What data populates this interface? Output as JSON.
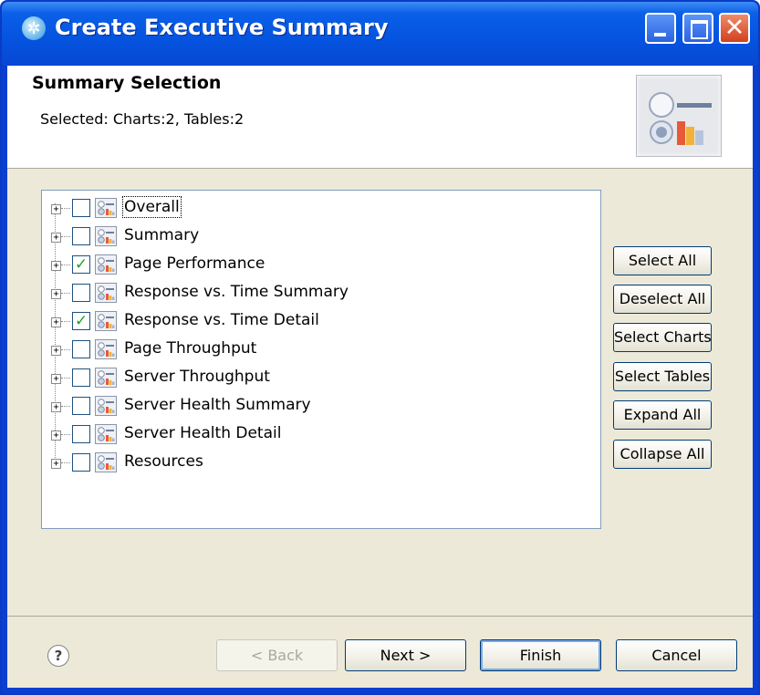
{
  "window": {
    "title": "Create Executive Summary",
    "icon": "app-icon"
  },
  "header": {
    "title": "Summary Selection",
    "description": "Selected: Charts:2, Tables:2",
    "banner_icon": "summary-report-icon"
  },
  "tree": {
    "items": [
      {
        "label": "Overall",
        "checked": false,
        "focused": true
      },
      {
        "label": "Summary",
        "checked": false
      },
      {
        "label": "Page Performance",
        "checked": true
      },
      {
        "label": "Response vs. Time Summary",
        "checked": false
      },
      {
        "label": "Response vs. Time Detail",
        "checked": true
      },
      {
        "label": "Page Throughput",
        "checked": false
      },
      {
        "label": "Server Throughput",
        "checked": false
      },
      {
        "label": "Server Health Summary",
        "checked": false
      },
      {
        "label": "Server Health Detail",
        "checked": false
      },
      {
        "label": "Resources",
        "checked": false
      }
    ]
  },
  "side_buttons": {
    "select_all": "Select All",
    "deselect_all": "Deselect All",
    "select_charts": "Select Charts",
    "select_tables": "Select Tables",
    "expand_all": "Expand All",
    "collapse_all": "Collapse All"
  },
  "footer": {
    "help_glyph": "?",
    "back": "< Back",
    "next": "Next >",
    "finish": "Finish",
    "cancel": "Cancel"
  },
  "colors": {
    "titlebar": "#0553df",
    "dialog_bg": "#ece9d8",
    "check_mark": "#21a121"
  }
}
